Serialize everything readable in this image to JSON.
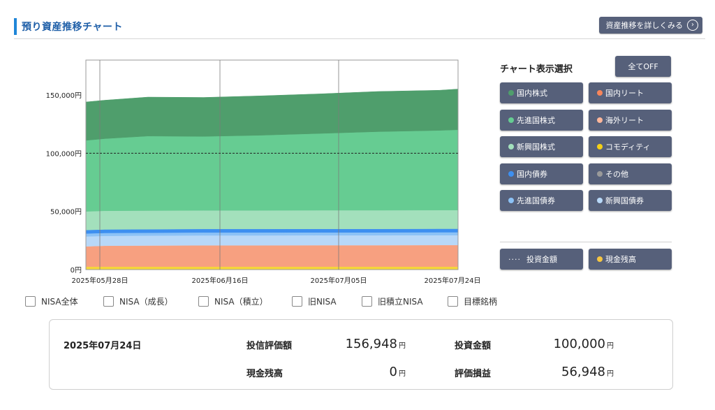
{
  "header": {
    "title": "預り資産推移チャート",
    "detail_label": "資産推移を詳しくみる",
    "detail_icon": "chevron-right-circle-icon"
  },
  "chart_data": {
    "type": "area",
    "stacked": true,
    "x_labels": [
      "2025年05月28日",
      "2025年06月16日",
      "2025年07月05日",
      "2025年07月24日"
    ],
    "y_ticks": [
      "0円",
      "50,000円",
      "100,000円",
      "150,000円"
    ],
    "ylim": [
      0,
      180000
    ],
    "grid": "vertical",
    "series_colors": {
      "commodity": "#f5d73a",
      "domestic_reit": "#f7a080",
      "foreign_reit": "#fcc2a8",
      "emerging_bond": "#b8d8f8",
      "developed_bond": "#8cc2f6",
      "domestic_bond": "#3d8ff0",
      "emerging_equity": "#a3e0bc",
      "developed_equity": "#66cc92",
      "domestic_equity": "#4f9e6c"
    },
    "investment_line": 100000,
    "samples": [
      {
        "x": 0,
        "y": [
          2500,
          17500,
          0,
          8500,
          2500,
          3000,
          16000,
          61000,
          33000
        ]
      },
      {
        "x": 3,
        "y": [
          2500,
          18000,
          0,
          8500,
          2500,
          3000,
          16000,
          62000,
          33000
        ]
      },
      {
        "x": 10,
        "y": [
          2500,
          18200,
          0,
          8500,
          2500,
          3000,
          16000,
          64000,
          33500
        ]
      },
      {
        "x": 19,
        "y": [
          2500,
          18400,
          0,
          8500,
          2500,
          3000,
          16000,
          63500,
          33500
        ]
      },
      {
        "x": 28,
        "y": [
          2500,
          18400,
          0,
          8500,
          2500,
          3000,
          16000,
          64500,
          33800
        ]
      },
      {
        "x": 38,
        "y": [
          2500,
          18500,
          0,
          8500,
          2500,
          3000,
          16000,
          66000,
          34000
        ]
      },
      {
        "x": 47,
        "y": [
          2500,
          18500,
          0,
          8500,
          2500,
          3000,
          16000,
          67500,
          34500
        ]
      },
      {
        "x": 57,
        "y": [
          2500,
          18600,
          0,
          8500,
          2500,
          3000,
          16000,
          68500,
          34500
        ]
      },
      {
        "x": 60,
        "y": [
          2500,
          18600,
          0,
          8500,
          2500,
          3000,
          16000,
          69000,
          35000
        ]
      }
    ]
  },
  "legend": {
    "title": "チャート表示選択",
    "all_off": "全てOFF",
    "items": [
      {
        "label": "国内株式",
        "color": "#4f9e6c",
        "name": "legend-domestic-equity"
      },
      {
        "label": "国内リート",
        "color": "#f7855a",
        "name": "legend-domestic-reit"
      },
      {
        "label": "先進国株式",
        "color": "#66cc92",
        "name": "legend-developed-equity"
      },
      {
        "label": "海外リート",
        "color": "#fcb69a",
        "name": "legend-foreign-reit"
      },
      {
        "label": "新興国株式",
        "color": "#a3e0bc",
        "name": "legend-emerging-equity"
      },
      {
        "label": "コモディティ",
        "color": "#f5d016",
        "name": "legend-commodity"
      },
      {
        "label": "国内債券",
        "color": "#3d8ff0",
        "name": "legend-domestic-bond"
      },
      {
        "label": "その他",
        "color": "#9a9a9a",
        "name": "legend-other"
      },
      {
        "label": "先進国債券",
        "color": "#8cc2f6",
        "name": "legend-developed-bond"
      },
      {
        "label": "新興国債券",
        "color": "#b8d8f8",
        "name": "legend-emerging-bond"
      }
    ],
    "investment_label": "投資金額",
    "cash_label": "現金残高",
    "cash_color": "#f5c542"
  },
  "filters": [
    {
      "label": "NISA全体",
      "name": "filter-nisa-all"
    },
    {
      "label": "NISA（成長）",
      "name": "filter-nisa-growth"
    },
    {
      "label": "NISA（積立）",
      "name": "filter-nisa-tsumitate"
    },
    {
      "label": "旧NISA",
      "name": "filter-old-nisa"
    },
    {
      "label": "旧積立NISA",
      "name": "filter-old-tsumitate-nisa"
    },
    {
      "label": "目標銘柄",
      "name": "filter-target-stocks"
    }
  ],
  "summary": {
    "date": "2025年07月24日",
    "fund_value_label": "投信評価額",
    "fund_value": "156,948",
    "investment_label": "投資金額",
    "investment": "100,000",
    "cash_label": "現金残高",
    "cash": "0",
    "gain_label": "評価損益",
    "gain": "56,948",
    "unit": "円"
  }
}
